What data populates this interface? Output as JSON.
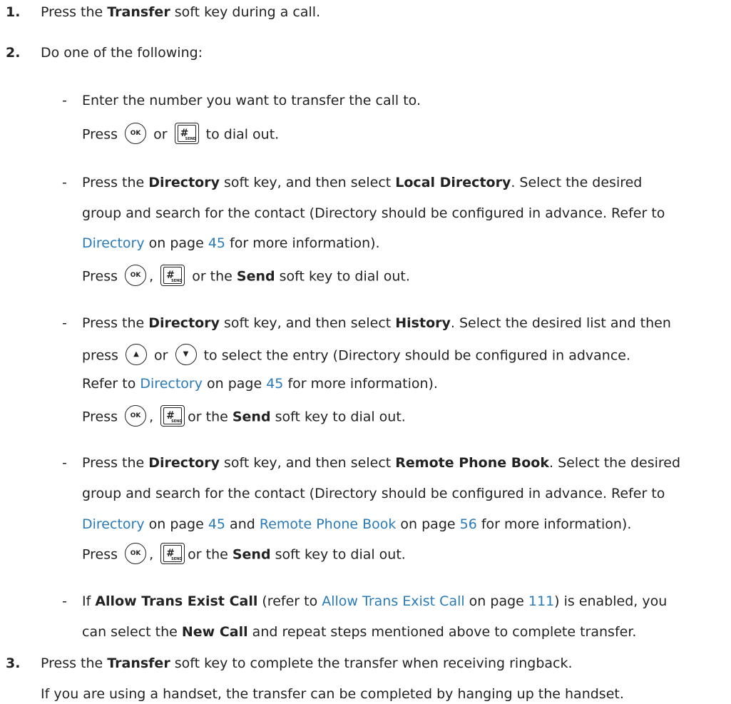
{
  "steps": [
    {
      "number": "1.",
      "t1": "Press the ",
      "b1": "Transfer",
      "t2": " soft key during a call."
    },
    {
      "number": "2.",
      "text": "Do one of the following:",
      "options": [
        {
          "dash": "-",
          "line1": "Enter the number you want to transfer the call to.",
          "press": {
            "press": "Press",
            "or": "or",
            "tail": "to dial out."
          }
        },
        {
          "dash": "-",
          "l1a": "Press the ",
          "l1b": "Directory",
          "l1c": " soft key, and then select ",
          "l1d": "Local Directory",
          "l1e": ". Select the desired",
          "l2": "group and search for the contact (Directory should be configured in advance. Refer to",
          "l3a": "Directory",
          "l3b": " on page ",
          "l3c": "45",
          "l3d": " for more information).",
          "press": {
            "press": "Press",
            "comma": ",",
            "or_the": " or the ",
            "send": "Send",
            "tail": " soft key to dial out."
          }
        },
        {
          "dash": "-",
          "l1a": "Press the ",
          "l1b": "Directory",
          "l1c": " soft key, and then select ",
          "l1d": "History",
          "l1e": ". Select the desired list and then",
          "l2a": "press",
          "l2or": "or",
          "l2b": "to select the entry (Directory should be configured in advance.",
          "l3a": "Refer to ",
          "l3b": "Directory",
          "l3c": " on page ",
          "l3d": "45",
          "l3e": " for more information).",
          "press": {
            "press": "Press",
            "comma": ",",
            "or_the": "or the ",
            "send": "Send",
            "tail": " soft key to dial out."
          }
        },
        {
          "dash": "-",
          "l1a": "Press the ",
          "l1b": "Directory",
          "l1c": " soft key, and then select ",
          "l1d": "Remote Phone Book",
          "l1e": ". Select the desired",
          "l2": "group and search for the contact (Directory should be configured in advance. Refer to",
          "l3a": "Directory",
          "l3b": " on page ",
          "l3c": "45",
          "l3d": " and ",
          "l3e": "Remote Phone Book",
          "l3f": " on page ",
          "l3g": "56",
          "l3h": " for more information).",
          "press": {
            "press": "Press",
            "comma": ",",
            "or_the": "or the ",
            "send": "Send",
            "tail": " soft key to dial out."
          }
        },
        {
          "dash": "-",
          "l1a": "If ",
          "l1b": "Allow Trans Exist Call",
          "l1c": " (refer to ",
          "l1d": "Allow Trans Exist Call",
          "l1e": " on page ",
          "l1f": "111",
          "l1g": ") is enabled, you",
          "l2a": "can select the ",
          "l2b": "New Call",
          "l2c": " and repeat steps mentioned above to complete transfer."
        }
      ]
    },
    {
      "number": "3.",
      "t1": "Press the ",
      "b1": "Transfer",
      "t2": " soft key to complete the transfer when receiving ringback.",
      "note": "If you are using a handset, the transfer can be completed by hanging up the handset."
    }
  ],
  "keys": {
    "ok": "OK",
    "hash": "#",
    "send_sub": "SEND",
    "up": "▲",
    "down": "▼"
  },
  "colors": {
    "text": "#222222",
    "link": "#2a7ab8"
  }
}
